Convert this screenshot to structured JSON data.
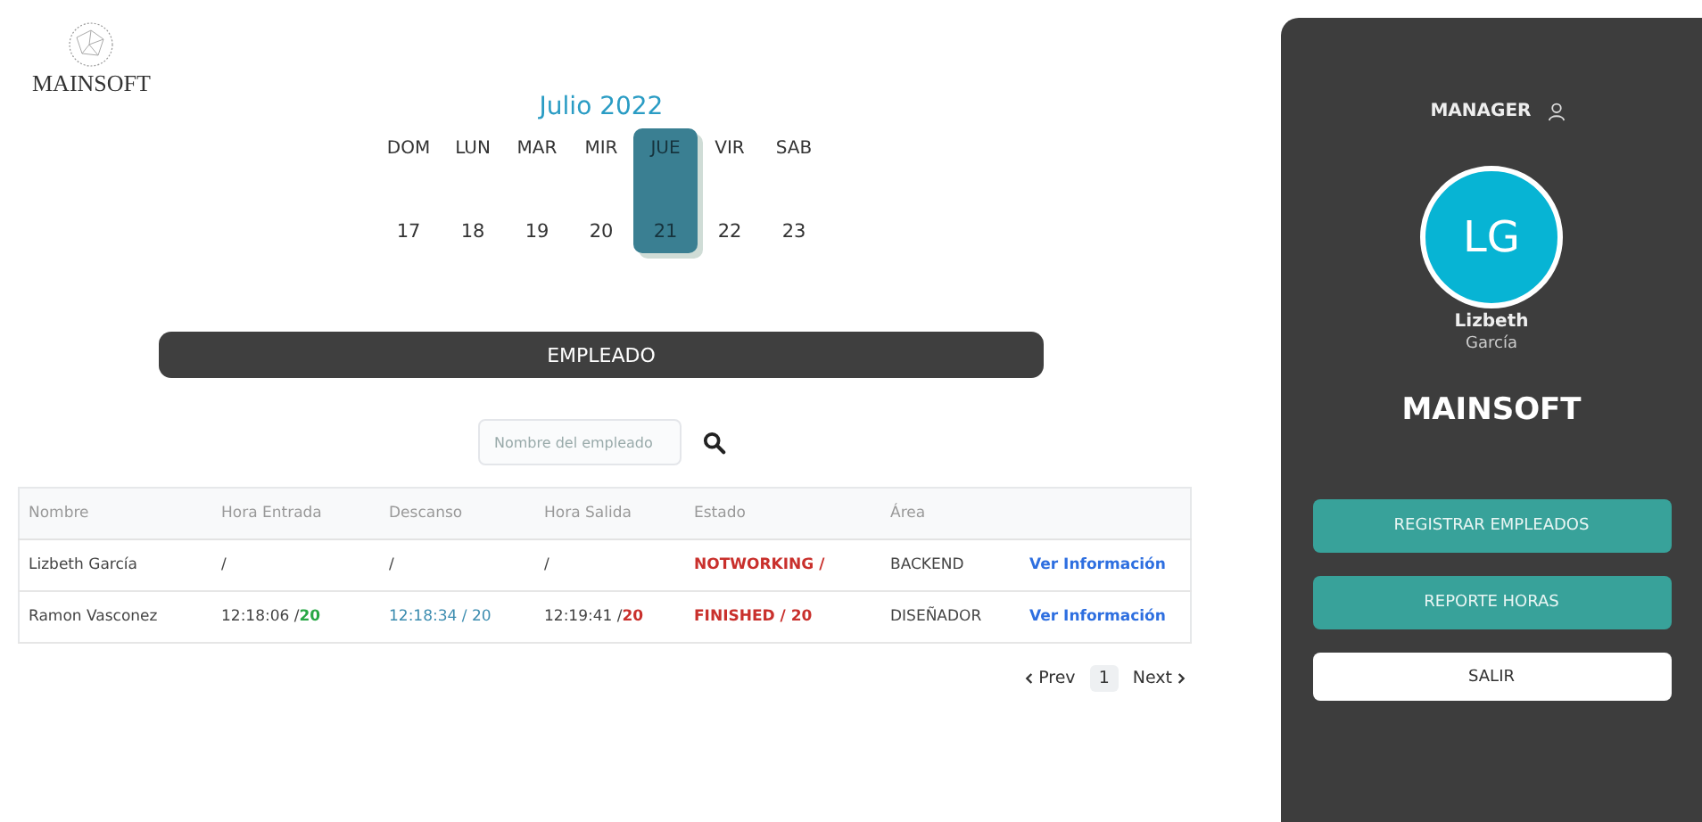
{
  "logo": {
    "text": "MAINSOFT"
  },
  "calendar": {
    "title": "Julio 2022",
    "days": [
      {
        "day": "DOM",
        "date": "17",
        "selected": false
      },
      {
        "day": "LUN",
        "date": "18",
        "selected": false
      },
      {
        "day": "MAR",
        "date": "19",
        "selected": false
      },
      {
        "day": "MIR",
        "date": "20",
        "selected": false
      },
      {
        "day": "JUE",
        "date": "21",
        "selected": true
      },
      {
        "day": "VIR",
        "date": "22",
        "selected": false
      },
      {
        "day": "SAB",
        "date": "23",
        "selected": false
      }
    ]
  },
  "section_bar": "EMPLEADO",
  "search": {
    "placeholder": "Nombre del empleado"
  },
  "table": {
    "columns": [
      "Nombre",
      "Hora Entrada",
      "Descanso",
      "Hora Salida",
      "Estado",
      "Área",
      ""
    ],
    "rows": [
      [
        [
          {
            "text": "Lizbeth García",
            "kind": "plain"
          }
        ],
        [
          {
            "text": "/",
            "kind": "plain"
          }
        ],
        [
          {
            "text": "/",
            "kind": "plain"
          }
        ],
        [
          {
            "text": "/",
            "kind": "plain"
          }
        ],
        [
          {
            "text": "NOTWORKING /",
            "kind": "alert"
          }
        ],
        [
          {
            "text": "BACKEND",
            "kind": "plain"
          }
        ],
        [
          {
            "text": "Ver Información",
            "kind": "link"
          }
        ]
      ],
      [
        [
          {
            "text": "Ramon Vasconez",
            "kind": "plain"
          }
        ],
        [
          {
            "text": "12:18:06 /",
            "kind": "plain"
          },
          {
            "text": "20",
            "kind": "good"
          }
        ],
        [
          {
            "text": "12:18:34 / 20",
            "kind": "info"
          }
        ],
        [
          {
            "text": "12:19:41 /",
            "kind": "plain"
          },
          {
            "text": "20",
            "kind": "alert"
          }
        ],
        [
          {
            "text": "FINISHED / 20",
            "kind": "alert"
          }
        ],
        [
          {
            "text": "DISEÑADOR",
            "kind": "plain"
          }
        ],
        [
          {
            "text": "Ver Información",
            "kind": "link"
          }
        ]
      ]
    ]
  },
  "pagination": {
    "prev": "Prev",
    "pages": [
      {
        "label": "1",
        "selected": true
      }
    ],
    "next": "Next"
  },
  "sidebar": {
    "role": "MANAGER",
    "avatar_initials": "LG",
    "first_name": "Lizbeth",
    "last_name": "García",
    "brand": "MAINSOFT",
    "buttons": [
      {
        "label": "REGISTRAR EMPLEADOS",
        "kind": "primary"
      },
      {
        "label": "REPORTE HORAS",
        "kind": "primary"
      },
      {
        "label": "SALIR",
        "kind": "plain"
      }
    ]
  }
}
